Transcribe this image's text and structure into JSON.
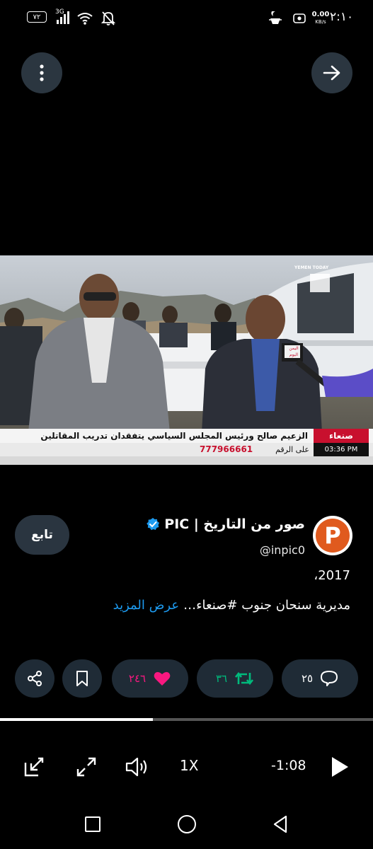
{
  "status_bar": {
    "time": "٢:١٠",
    "speed_value": "0.00",
    "speed_unit": "KB/s",
    "battery": "٧٢",
    "network": "3G"
  },
  "video": {
    "city_label": "صنعاء",
    "headline": "الزعيم صالح ورئيس المجلس السياسي يتفقدان تدريب المقاتلين",
    "ticker_time": "03:36 PM",
    "ticker_prefix": "على الرقم",
    "ticker_number": "777966661",
    "channel_name": "YEMEN TODAY",
    "mic_logo": "اليمن اليوم"
  },
  "tweet": {
    "display_name": "صور من التاريخ | PIC",
    "handle": "@inpic0",
    "avatar_letter": "P",
    "follow_label": "تابع",
    "text_line1": "2017،",
    "text_line2": "مديرية سنحان جنوب #صنعاء…",
    "show_more": "عرض المزيد"
  },
  "actions": {
    "replies": "٢٥",
    "retweets": "٣٦",
    "likes": "٢٤٦"
  },
  "player": {
    "speed": "1X",
    "time_remaining": "-1:08",
    "progress": 0.41
  },
  "colors": {
    "accent_blue": "#1d9bf0",
    "retweet_green": "#00ba7c",
    "like_pink": "#f91880",
    "avatar_orange": "#e05a1e",
    "ticker_red": "#c8102e"
  }
}
